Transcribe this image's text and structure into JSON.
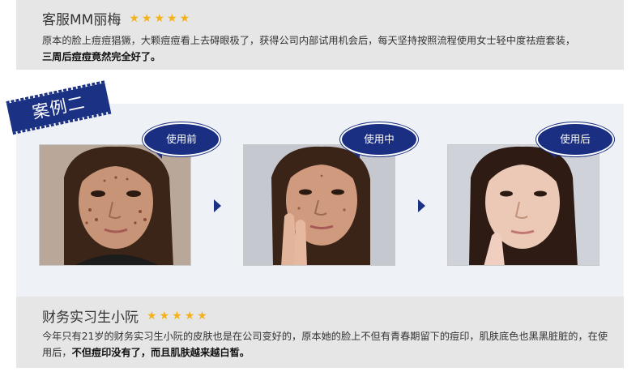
{
  "testimonial_top": {
    "name": "客服MM丽梅",
    "rating": 5,
    "text": "原本的脸上痘痘猖獗，大颗痘痘看上去碍眼极了，获得公司内部试用机会后，每天坚持按照流程使用女士轻中度祛痘套装，",
    "text_bold": "三周后痘痘竟然完全好了。"
  },
  "case": {
    "label": "案例二",
    "stages": [
      {
        "label": "使用前"
      },
      {
        "label": "使用中"
      },
      {
        "label": "使用后"
      }
    ]
  },
  "testimonial_bottom": {
    "name": "财务实习生小阮",
    "rating": 5,
    "text": "今年只有21岁的财务实习生小阮的皮肤也是在公司变好的，原本她的脸上不但有青春期留下的痘印，肌肤底色也黑黑脏脏的，在使用后，",
    "text_bold": "不但痘印没有了，而且肌肤越来越白皙。"
  },
  "colors": {
    "accent": "#1b3184",
    "star": "#f3b21a",
    "card_bg": "#e6e6e6",
    "panel_bg": "#eef1f6"
  }
}
